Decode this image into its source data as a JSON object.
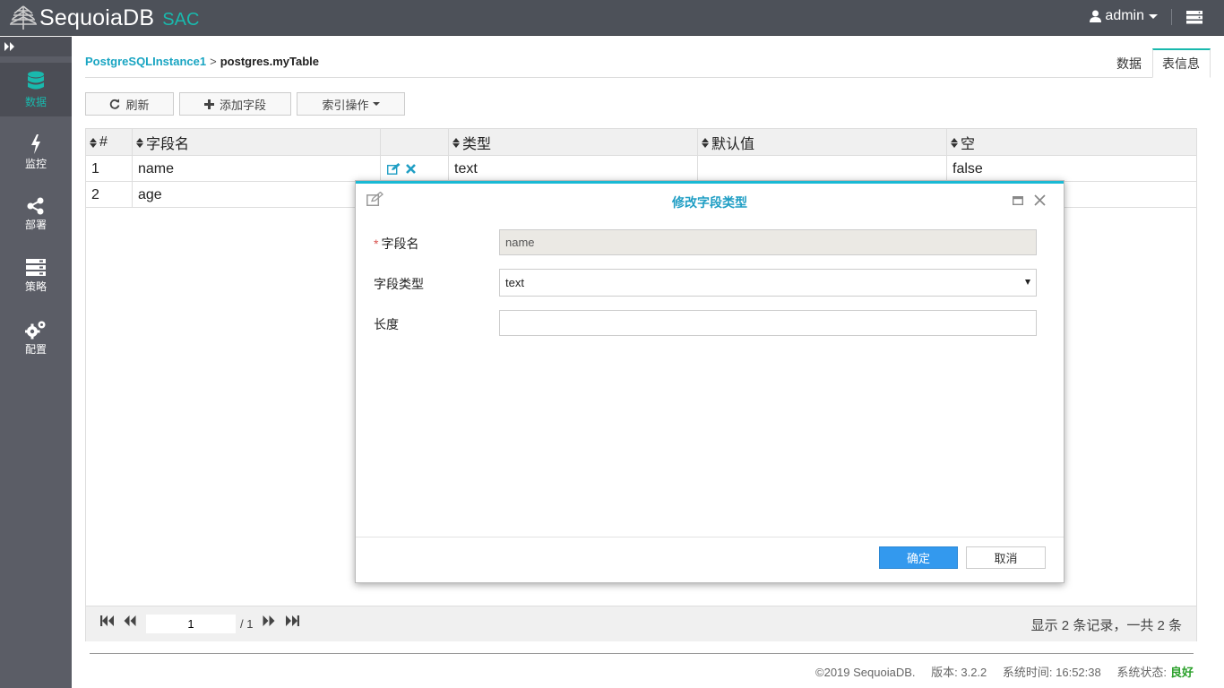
{
  "header": {
    "brand_name": "SequoiaDB",
    "brand_suffix": "SAC",
    "user": "admin"
  },
  "sidebar": {
    "items": [
      {
        "label": "数据",
        "icon": "database-icon",
        "active": true
      },
      {
        "label": "监控",
        "icon": "bolt-icon"
      },
      {
        "label": "部署",
        "icon": "share-icon"
      },
      {
        "label": "策略",
        "icon": "server-icon"
      },
      {
        "label": "配置",
        "icon": "gears-icon"
      }
    ]
  },
  "breadcrumb": {
    "instance": "PostgreSQLInstance1",
    "separator": ">",
    "current": "postgres.myTable"
  },
  "tabs": [
    {
      "label": "数据"
    },
    {
      "label": "表信息",
      "active": true
    }
  ],
  "toolbar": {
    "refresh_label": "刷新",
    "add_field_label": "添加字段",
    "index_ops_label": "索引操作"
  },
  "grid": {
    "columns": [
      "#",
      "字段名",
      "",
      "类型",
      "默认值",
      "空"
    ],
    "rows": [
      {
        "index": "1",
        "name": "name",
        "type": "text",
        "default": "",
        "nullable": "false"
      },
      {
        "index": "2",
        "name": "age",
        "type": "",
        "default": "",
        "nullable": ""
      }
    ],
    "pager": {
      "current_page": "1",
      "total_pages": "/ 1",
      "summary": "显示 2 条记录，一共 2 条"
    }
  },
  "footer": {
    "copyright": "©2019 SequoiaDB.",
    "version": "版本: 3.2.2",
    "system_time": "系统时间: 16:52:38",
    "status_label": "系统状态:",
    "status_value": "良好"
  },
  "modal": {
    "title": "修改字段类型",
    "field_name_label": "字段名",
    "field_name_value": "name",
    "field_type_label": "字段类型",
    "field_type_value": "text",
    "length_label": "长度",
    "length_value": "",
    "ok_label": "确定",
    "cancel_label": "取消"
  },
  "colors": {
    "accent": "#19b9ad",
    "link": "#19a5c2",
    "primary_button": "#3399ee",
    "status_good": "#2aa02a"
  }
}
